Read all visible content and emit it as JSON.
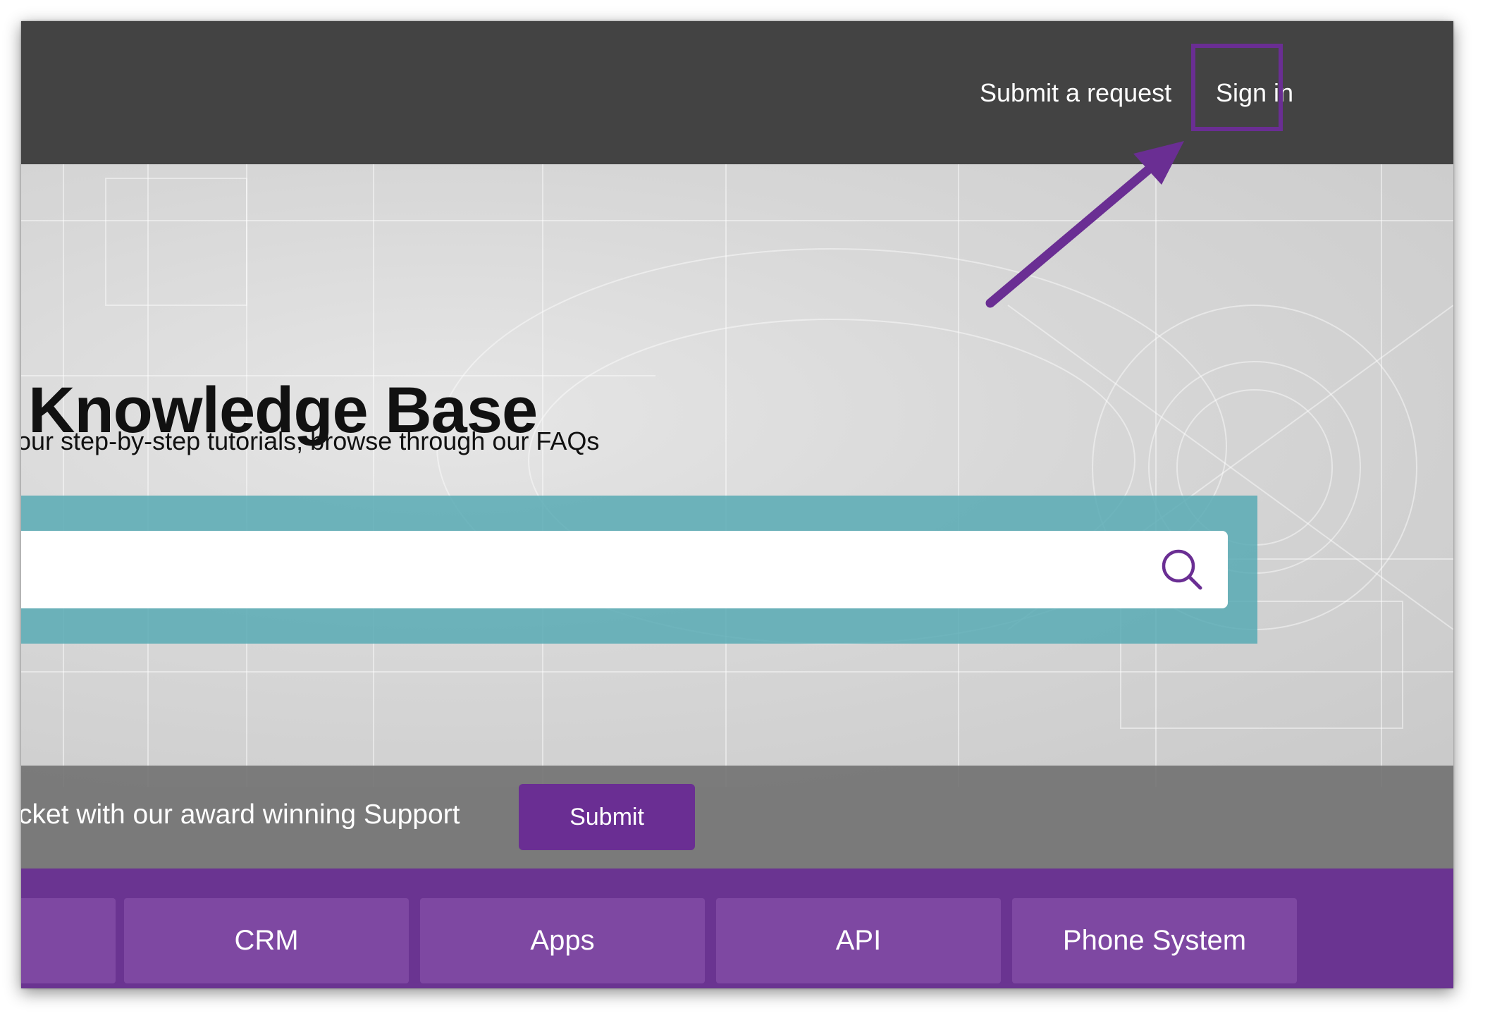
{
  "header": {
    "submit_request": "Submit a request",
    "sign_in": "Sign in"
  },
  "hero": {
    "title": "Knowledge Base",
    "subtitle": "our step-by-step tutorials, browse through our FAQs",
    "search_placeholder": ""
  },
  "ticket_bar": {
    "text": "cket with our award winning Support",
    "submit_label": "Submit"
  },
  "categories": [
    {
      "label": ""
    },
    {
      "label": "CRM"
    },
    {
      "label": "Apps"
    },
    {
      "label": "API"
    },
    {
      "label": "Phone System"
    }
  ],
  "icons": {
    "search": "search-icon",
    "arrow": "arrow-annotation"
  },
  "colors": {
    "header_bg": "#434343",
    "accent_purple": "#6a2e93",
    "search_band": "#58aab4",
    "category_bar": "#6a3491",
    "category_tile": "#7e48a2"
  }
}
